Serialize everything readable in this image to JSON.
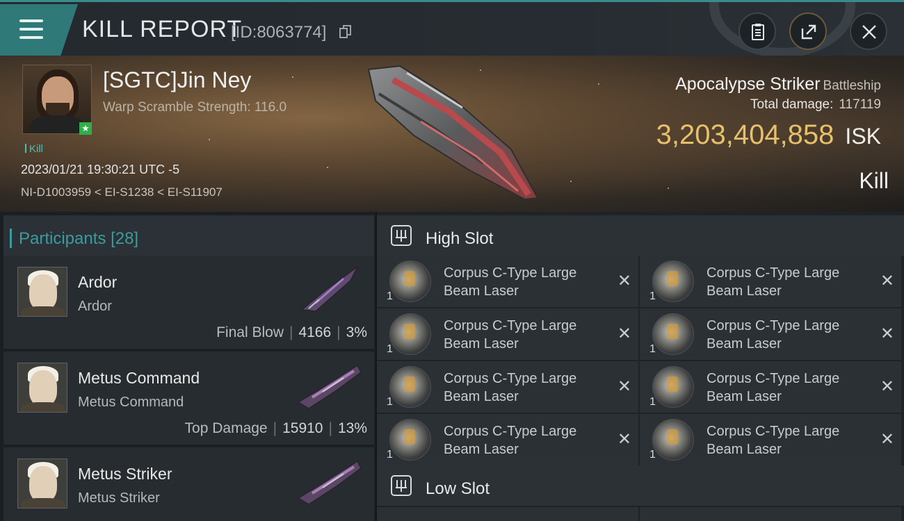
{
  "header": {
    "title": "KILL REPORT",
    "report_id": "[ID:8063774]"
  },
  "victim": {
    "pilot": "[SGTC]Jin Ney",
    "warp_scramble": "Warp Scramble Strength: 116.0",
    "tag": "Kill",
    "datetime": "2023/01/21 19:30:21 UTC -5",
    "location": "NI-D1003959 < EI-S1238 < EI-S11907",
    "ship_name": "Apocalypse Striker",
    "ship_class": "Battleship",
    "total_damage_label": "Total damage:",
    "total_damage": "117119",
    "isk_value": "3,203,404,858",
    "isk_unit": "ISK",
    "result": "Kill"
  },
  "participants": {
    "label": "Participants",
    "count": "[28]",
    "items": [
      {
        "name": "Ardor",
        "corp": "Ardor",
        "stat_label": "Final Blow",
        "damage": "4166",
        "percent": "3%"
      },
      {
        "name": "Metus Command",
        "corp": "Metus Command",
        "stat_label": "Top Damage",
        "damage": "15910",
        "percent": "13%"
      },
      {
        "name": "Metus Striker",
        "corp": "Metus Striker",
        "stat_label": "",
        "damage": "",
        "percent": ""
      }
    ]
  },
  "fitting": {
    "high_slot_label": "High Slot",
    "low_slot_label": "Low Slot",
    "high_modules": [
      {
        "line1": "Corpus C-Type Large",
        "line2": "Beam Laser",
        "qty": "1"
      },
      {
        "line1": "Corpus C-Type Large",
        "line2": "Beam Laser",
        "qty": "1"
      },
      {
        "line1": "Corpus C-Type Large",
        "line2": "Beam Laser",
        "qty": "1"
      },
      {
        "line1": "Corpus C-Type Large",
        "line2": "Beam Laser",
        "qty": "1"
      },
      {
        "line1": "Corpus C-Type Large",
        "line2": "Beam Laser",
        "qty": "1"
      },
      {
        "line1": "Corpus C-Type Large",
        "line2": "Beam Laser",
        "qty": "1"
      },
      {
        "line1": "Corpus C-Type Large",
        "line2": "Beam Laser",
        "qty": "1"
      },
      {
        "line1": "Corpus C-Type Large",
        "line2": "Beam Laser",
        "qty": "1"
      }
    ],
    "remove_glyph": "✕"
  },
  "colors": {
    "accent": "#3a9d9c",
    "isk": "#e6c06a",
    "menu": "#2f7a79"
  },
  "icons": [
    "menu-icon",
    "copy-icon",
    "clipboard-icon",
    "share-icon",
    "close-icon",
    "slot-icon",
    "remove-icon"
  ]
}
